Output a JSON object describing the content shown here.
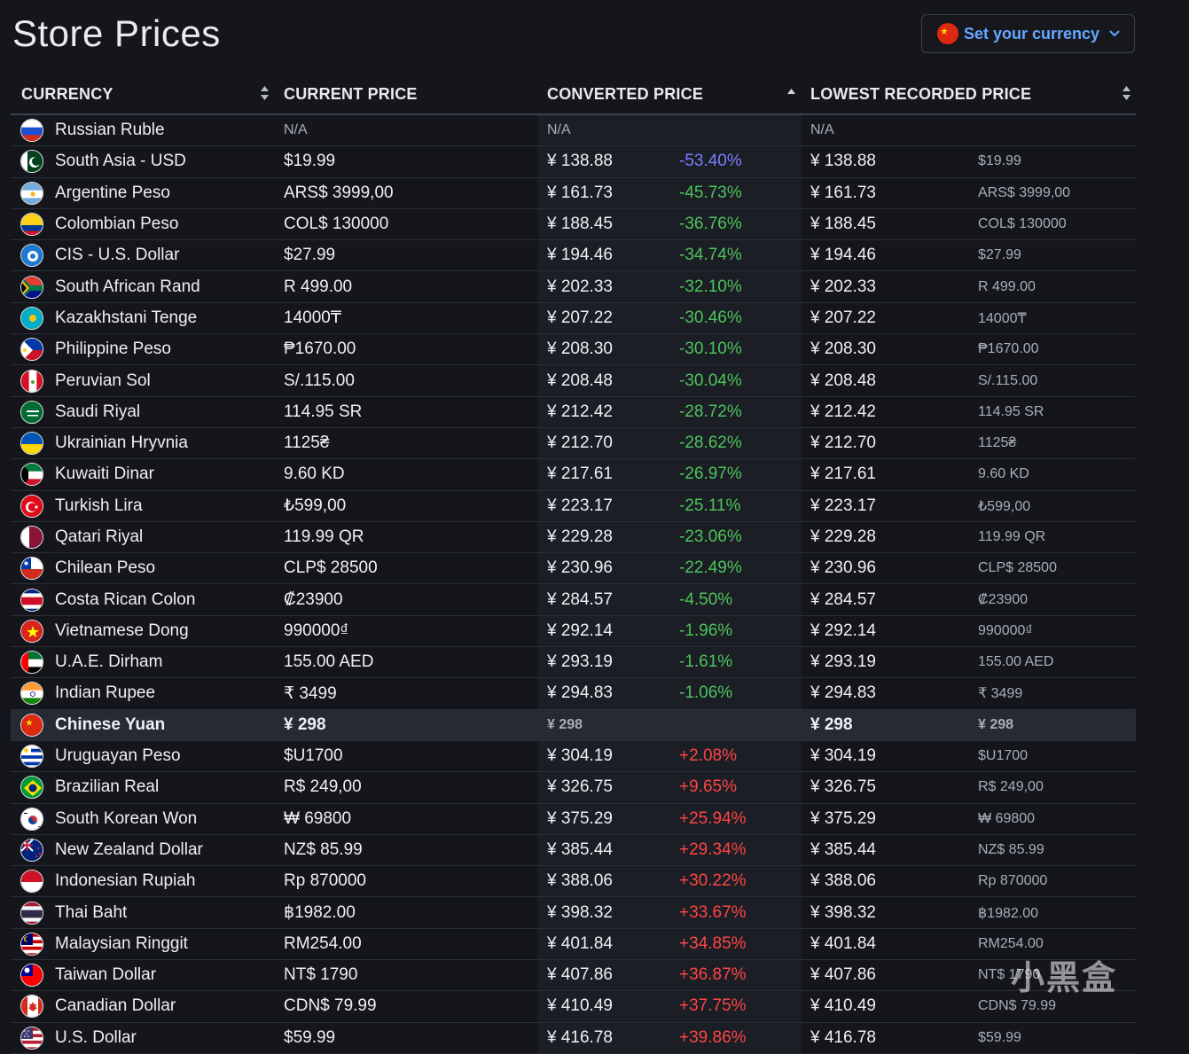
{
  "page": {
    "title": "Store Prices",
    "currency_button": "Set your currency",
    "watermark": "小黑盒"
  },
  "headers": {
    "currency": "CURRENCY",
    "current": "CURRENT PRICE",
    "converted": "CONVERTED PRICE",
    "lowest": "LOWEST RECORDED PRICE"
  },
  "rows": [
    {
      "flag": "ru",
      "name": "Russian Ruble",
      "current": "N/A",
      "converted": "N/A",
      "pct": "",
      "lowest": "N/A",
      "lowest_orig": ""
    },
    {
      "flag": "pk",
      "name": "South Asia - USD",
      "current": "$19.99",
      "converted": "¥ 138.88",
      "pct": "-53.40%",
      "lowest": "¥ 138.88",
      "lowest_orig": "$19.99"
    },
    {
      "flag": "ar",
      "name": "Argentine Peso",
      "current": "ARS$ 3999,00",
      "converted": "¥ 161.73",
      "pct": "-45.73%",
      "lowest": "¥ 161.73",
      "lowest_orig": "ARS$ 3999,00"
    },
    {
      "flag": "co",
      "name": "Colombian Peso",
      "current": "COL$ 130000",
      "converted": "¥ 188.45",
      "pct": "-36.76%",
      "lowest": "¥ 188.45",
      "lowest_orig": "COL$ 130000"
    },
    {
      "flag": "cis",
      "name": "CIS - U.S. Dollar",
      "current": "$27.99",
      "converted": "¥ 194.46",
      "pct": "-34.74%",
      "lowest": "¥ 194.46",
      "lowest_orig": "$27.99"
    },
    {
      "flag": "za",
      "name": "South African Rand",
      "current": "R 499.00",
      "converted": "¥ 202.33",
      "pct": "-32.10%",
      "lowest": "¥ 202.33",
      "lowest_orig": "R 499.00"
    },
    {
      "flag": "kz",
      "name": "Kazakhstani Tenge",
      "current": "14000₸",
      "converted": "¥ 207.22",
      "pct": "-30.46%",
      "lowest": "¥ 207.22",
      "lowest_orig": "14000₸"
    },
    {
      "flag": "ph",
      "name": "Philippine Peso",
      "current": "₱1670.00",
      "converted": "¥ 208.30",
      "pct": "-30.10%",
      "lowest": "¥ 208.30",
      "lowest_orig": "₱1670.00"
    },
    {
      "flag": "pe",
      "name": "Peruvian Sol",
      "current": "S/.115.00",
      "converted": "¥ 208.48",
      "pct": "-30.04%",
      "lowest": "¥ 208.48",
      "lowest_orig": "S/.115.00"
    },
    {
      "flag": "sa",
      "name": "Saudi Riyal",
      "current": "114.95 SR",
      "converted": "¥ 212.42",
      "pct": "-28.72%",
      "lowest": "¥ 212.42",
      "lowest_orig": "114.95 SR"
    },
    {
      "flag": "ua",
      "name": "Ukrainian Hryvnia",
      "current": "1125₴",
      "converted": "¥ 212.70",
      "pct": "-28.62%",
      "lowest": "¥ 212.70",
      "lowest_orig": "1125₴"
    },
    {
      "flag": "kw",
      "name": "Kuwaiti Dinar",
      "current": "9.60 KD",
      "converted": "¥ 217.61",
      "pct": "-26.97%",
      "lowest": "¥ 217.61",
      "lowest_orig": "9.60 KD"
    },
    {
      "flag": "tr",
      "name": "Turkish Lira",
      "current": "₺599,00",
      "converted": "¥ 223.17",
      "pct": "-25.11%",
      "lowest": "¥ 223.17",
      "lowest_orig": "₺599,00"
    },
    {
      "flag": "qa",
      "name": "Qatari Riyal",
      "current": "119.99 QR",
      "converted": "¥ 229.28",
      "pct": "-23.06%",
      "lowest": "¥ 229.28",
      "lowest_orig": "119.99 QR"
    },
    {
      "flag": "cl",
      "name": "Chilean Peso",
      "current": "CLP$ 28500",
      "converted": "¥ 230.96",
      "pct": "-22.49%",
      "lowest": "¥ 230.96",
      "lowest_orig": "CLP$ 28500"
    },
    {
      "flag": "cr",
      "name": "Costa Rican Colon",
      "current": "₡23900",
      "converted": "¥ 284.57",
      "pct": "-4.50%",
      "lowest": "¥ 284.57",
      "lowest_orig": "₡23900"
    },
    {
      "flag": "vn",
      "name": "Vietnamese Dong",
      "current": "990000₫",
      "converted": "¥ 292.14",
      "pct": "-1.96%",
      "lowest": "¥ 292.14",
      "lowest_orig": "990000₫"
    },
    {
      "flag": "ae",
      "name": "U.A.E. Dirham",
      "current": "155.00 AED",
      "converted": "¥ 293.19",
      "pct": "-1.61%",
      "lowest": "¥ 293.19",
      "lowest_orig": "155.00 AED"
    },
    {
      "flag": "in",
      "name": "Indian Rupee",
      "current": "₹ 3499",
      "converted": "¥ 294.83",
      "pct": "-1.06%",
      "lowest": "¥ 294.83",
      "lowest_orig": "₹ 3499"
    },
    {
      "flag": "cn",
      "name": "Chinese Yuan",
      "current": "¥ 298",
      "converted": "¥ 298",
      "pct": "",
      "lowest": "¥ 298",
      "lowest_orig": "¥ 298",
      "highlight": true
    },
    {
      "flag": "uy",
      "name": "Uruguayan Peso",
      "current": "$U1700",
      "converted": "¥ 304.19",
      "pct": "+2.08%",
      "lowest": "¥ 304.19",
      "lowest_orig": "$U1700"
    },
    {
      "flag": "br",
      "name": "Brazilian Real",
      "current": "R$ 249,00",
      "converted": "¥ 326.75",
      "pct": "+9.65%",
      "lowest": "¥ 326.75",
      "lowest_orig": "R$ 249,00"
    },
    {
      "flag": "kr",
      "name": "South Korean Won",
      "current": "₩ 69800",
      "converted": "¥ 375.29",
      "pct": "+25.94%",
      "lowest": "¥ 375.29",
      "lowest_orig": "₩ 69800"
    },
    {
      "flag": "nz",
      "name": "New Zealand Dollar",
      "current": "NZ$ 85.99",
      "converted": "¥ 385.44",
      "pct": "+29.34%",
      "lowest": "¥ 385.44",
      "lowest_orig": "NZ$ 85.99"
    },
    {
      "flag": "id",
      "name": "Indonesian Rupiah",
      "current": "Rp 870000",
      "converted": "¥ 388.06",
      "pct": "+30.22%",
      "lowest": "¥ 388.06",
      "lowest_orig": "Rp 870000"
    },
    {
      "flag": "th",
      "name": "Thai Baht",
      "current": "฿1982.00",
      "converted": "¥ 398.32",
      "pct": "+33.67%",
      "lowest": "¥ 398.32",
      "lowest_orig": "฿1982.00"
    },
    {
      "flag": "my",
      "name": "Malaysian Ringgit",
      "current": "RM254.00",
      "converted": "¥ 401.84",
      "pct": "+34.85%",
      "lowest": "¥ 401.84",
      "lowest_orig": "RM254.00"
    },
    {
      "flag": "tw",
      "name": "Taiwan Dollar",
      "current": "NT$ 1790",
      "converted": "¥ 407.86",
      "pct": "+36.87%",
      "lowest": "¥ 407.86",
      "lowest_orig": "NT$ 1790"
    },
    {
      "flag": "ca",
      "name": "Canadian Dollar",
      "current": "CDN$ 79.99",
      "converted": "¥ 410.49",
      "pct": "+37.75%",
      "lowest": "¥ 410.49",
      "lowest_orig": "CDN$ 79.99"
    },
    {
      "flag": "us",
      "name": "U.S. Dollar",
      "current": "$59.99",
      "converted": "¥ 416.78",
      "pct": "+39.86%",
      "lowest": "¥ 416.78",
      "lowest_orig": "$59.99"
    }
  ],
  "colors": {
    "accent": "#67a7ff",
    "negative_pct": "#4ec35a",
    "lowest_negative_pct": "#7a7cff",
    "positive_pct": "#ff4545"
  }
}
